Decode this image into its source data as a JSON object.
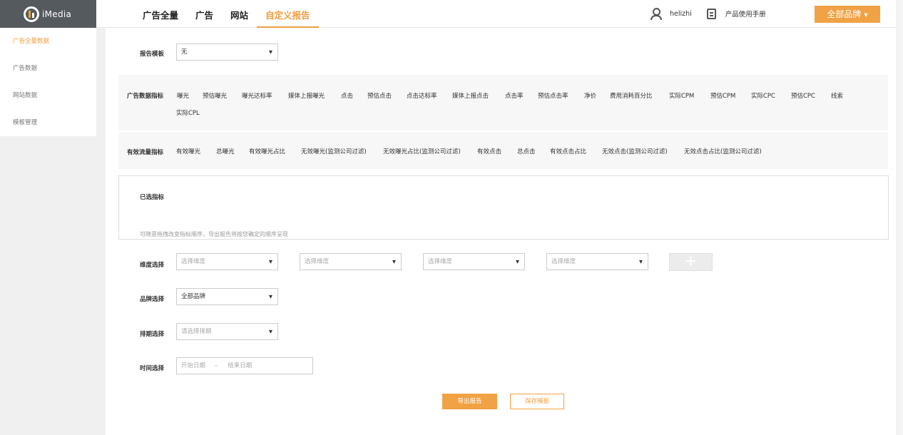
{
  "app": {
    "logo_text": "iMedia"
  },
  "nav": {
    "items": [
      "广告全量",
      "广告",
      "网站",
      "自定义报告"
    ],
    "active": "自定义报告"
  },
  "user": {
    "name": "helizhi",
    "manual_label": "产品使用手册"
  },
  "brand_button": {
    "label": "全部品牌"
  },
  "sidebar": {
    "items": [
      "广告全量数据",
      "广告数据",
      "网站数据",
      "模板管理"
    ],
    "active": "广告全量数据"
  },
  "form": {
    "template": {
      "label": "报告模板",
      "value": "无"
    },
    "ad_metrics": {
      "label": "广告数据指标",
      "items": [
        "曝光",
        "预估曝光",
        "曝光达标率",
        "媒体上报曝光",
        "点击",
        "预估点击",
        "点击达标率",
        "媒体上报点击",
        "点击率",
        "预估点击率",
        "净价",
        "费用消耗百分比",
        "实际CPM",
        "预估CPM",
        "实际CPC",
        "预估CPC",
        "线索",
        "实际CPL"
      ]
    },
    "traffic_metrics": {
      "label": "有效流量指标",
      "items": [
        "有效曝光",
        "总曝光",
        "有效曝光占比",
        "无效曝光(监测公司过滤)",
        "无效曝光占比(监测公司过滤)",
        "有效点击",
        "总点击",
        "有效点击占比",
        "无效点击(监测公司过滤)",
        "无效点击占比(监测公司过滤)"
      ]
    },
    "selected": {
      "label": "已选指标",
      "hint": "可随意拖拽改变指标顺序，导出报告将按您确定的顺序呈现"
    },
    "dimension": {
      "label": "维度选择",
      "placeholders": [
        "选择维度",
        "选择维度",
        "选择维度",
        "选择维度"
      ],
      "add_symbol": "+"
    },
    "brand": {
      "label": "品牌选择",
      "value": "全部品牌"
    },
    "schedule": {
      "label": "排期选择",
      "placeholder": "请选择排期"
    },
    "time": {
      "label": "时间选择",
      "start_placeholder": "开始日期",
      "separator": "–",
      "end_placeholder": "结束日期"
    }
  },
  "actions": {
    "export_label": "导出报告",
    "save_label": "保存模板"
  },
  "icons": {
    "arrow": "▼",
    "caret": "▼"
  },
  "colors": {
    "accent": "#f1a244",
    "logo_bg": "#555a5f"
  }
}
